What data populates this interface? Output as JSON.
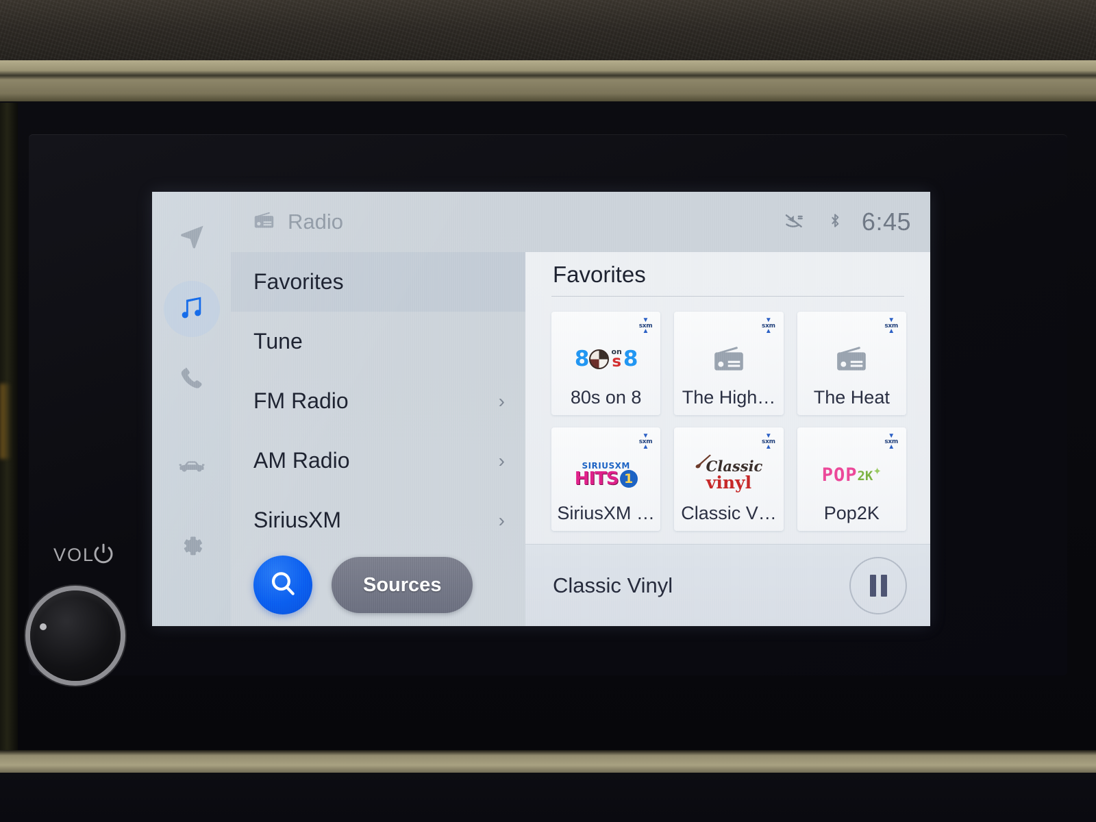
{
  "hardware": {
    "vol_label": "VOL",
    "power_icon": "power-icon",
    "knob_name": "volume-knob"
  },
  "sidebar": {
    "items": [
      {
        "icon": "navigation-arrow-icon",
        "name": "navigation",
        "active": false
      },
      {
        "icon": "music-note-icon",
        "name": "media",
        "active": true
      },
      {
        "icon": "phone-icon",
        "name": "phone",
        "active": false
      },
      {
        "icon": "car-icon",
        "name": "vehicle",
        "active": false
      },
      {
        "icon": "gear-icon",
        "name": "settings",
        "active": false
      }
    ]
  },
  "menu": {
    "header": {
      "icon": "radio-icon",
      "title": "Radio"
    },
    "items": [
      {
        "label": "Favorites",
        "chevron": "",
        "selected": true
      },
      {
        "label": "Tune",
        "chevron": "",
        "selected": false
      },
      {
        "label": "FM Radio",
        "chevron": "›",
        "selected": false
      },
      {
        "label": "AM Radio",
        "chevron": "›",
        "selected": false
      },
      {
        "label": "SiriusXM",
        "chevron": "›",
        "selected": false
      }
    ],
    "actions": {
      "search_icon": "search-icon",
      "sources_label": "Sources"
    }
  },
  "status_bar": {
    "mute_icon": "volume-mute-icon",
    "bluetooth_icon": "bluetooth-icon",
    "time": "6:45"
  },
  "content": {
    "title": "Favorites",
    "tiles": [
      {
        "label": "80s on 8",
        "art": "logo-80s-on-8",
        "badge": "sxm-badge"
      },
      {
        "label": "The High…",
        "art": "radio-generic-icon",
        "badge": "sxm-badge"
      },
      {
        "label": "The Heat",
        "art": "radio-generic-icon",
        "badge": "sxm-badge"
      },
      {
        "label": "SiriusXM …",
        "art": "logo-siriusxm-hits-1",
        "badge": "sxm-badge"
      },
      {
        "label": "Classic V…",
        "art": "logo-classic-vinyl",
        "badge": "sxm-badge"
      },
      {
        "label": "Pop2K",
        "art": "logo-pop2k",
        "badge": "sxm-badge"
      }
    ],
    "badge_text": {
      "top": "▼",
      "word": "sxm",
      "bottom": "▲"
    }
  },
  "now_playing": {
    "title": "Classic Vinyl",
    "transport_state": "playing",
    "transport_icon": "pause-icon"
  },
  "colors": {
    "accent_blue": "#0b5ff0",
    "screen_bg": "#e9edf1",
    "rail_bg": "#ccd4dc",
    "selected_row": "#c3ccd6",
    "sources_gray": "#6c7080",
    "text_dark": "#1d2230",
    "text_muted": "#8e98a4"
  }
}
